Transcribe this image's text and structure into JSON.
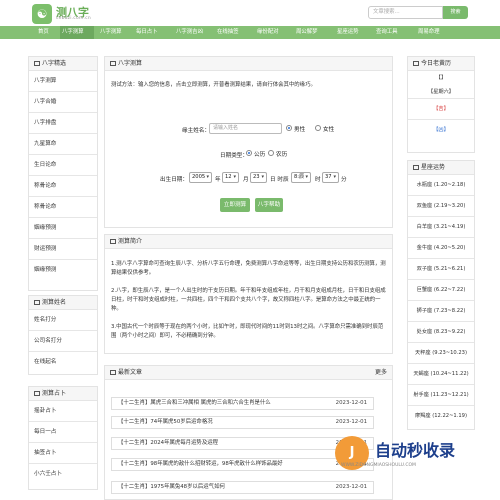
{
  "header": {
    "logo_char": "☯",
    "site_title": "测八字",
    "site_subtitle": "cebazi.com.cn",
    "search_placeholder": "文章搜索...",
    "search_button": "搜索"
  },
  "nav": [
    "首页",
    "八字测算",
    "八字测算",
    "每日占卜",
    "八字测吉凶",
    "在线抽签",
    "缘份配对",
    "周公解梦",
    "星座运势",
    "查询工具",
    "周易命理"
  ],
  "left": {
    "bazi_title": "八字精选",
    "bazi_items": [
      "八字测算",
      "八字合婚",
      "八字排盘",
      "九星算命",
      "生日论命",
      "称骨论命",
      "称骨论命",
      "姻缘预测",
      "财运预测",
      "姻缘预测"
    ],
    "name_title": "测算姓名",
    "name_items": [
      "姓名打分",
      "公司名打分",
      "在线起名"
    ],
    "divine_title": "测算占卜",
    "divine_items": [
      "摇卦占卜",
      "每日一占",
      "抽签占卜",
      "小六壬占卜"
    ]
  },
  "form": {
    "title": "八字测算",
    "intro": "测试方法：输入您的信息，点击立即测算，开普看测算结果，请自行体会其中的缘巧。",
    "name_label": "缘主姓名：",
    "name_placeholder": "请输入姓名",
    "male": "男性",
    "female": "女性",
    "date_type_label": "日期类型：",
    "solar": "公历",
    "lunar": "农历",
    "birth_label": "出生日期：",
    "year": "2005",
    "year_unit": "年",
    "month": "12",
    "month_unit": "月",
    "day": "23",
    "day_unit": "日 时辰",
    "hour": "8:辰",
    "hour_unit": "时",
    "minute": "37",
    "minute_unit": "分",
    "submit": "立即测算",
    "help": "八字帮助"
  },
  "intro": {
    "title": "测算简介",
    "p1": "1.测八字八字算命可查询生辰八字、分析八字五行命理，免费测算八字命运等等，出生日期支持公历和农历测算，测算结果仅供参考。",
    "p2": "2.八字，即生辰八字，是一个人出生时的干支历日期。年干和年支组成年柱，月干和月支组成月柱，日干和日支组成日柱，时干和时支组成时柱，一共四柱，四个干和四个支共八个字，故又称四柱八字。是算命方法之中最正统的一种。",
    "p3": "3.中国古代一个时辰等于现在的两个小时，比如午时，即现代时间的11时到13时之间。八字算命只需准确到时辰范围（两个小时之间）即可，不必精确到分钟。"
  },
  "articles": {
    "title": "最新文章",
    "more": "更多",
    "items": [
      {
        "tag": "【十二生肖】",
        "text": "属虎三合和三冲属相 属虎的三合和六合生肖是什么",
        "date": "2023-12-01"
      },
      {
        "tag": "【十二生肖】",
        "text": "74年属虎50岁后运命格况",
        "date": "2023-12-01"
      },
      {
        "tag": "【十二生肖】",
        "text": "2024年属虎每月运势及运程",
        "date": "2023-12-01"
      },
      {
        "tag": "【十二生肖】",
        "text": "98年属虎的敌什么招财转运，98年虎敌什么样饰品最好",
        "date": "2023-12-01"
      },
      {
        "tag": "【十二生肖】",
        "text": "1975年属兔48岁以后运气如何",
        "date": "2023-12-01"
      }
    ]
  },
  "right": {
    "today_title": "今日老黄历",
    "today_items": [
      "【】",
      "【星期六】",
      "【吉】",
      "【凶】"
    ],
    "star_title": "星座运势",
    "stars": [
      "水瓶座 (1.20~2.18)",
      "双鱼座 (2.19~3.20)",
      "白羊座 (3.21~4.19)",
      "金牛座 (4.20~5.20)",
      "双子座 (5.21~6.21)",
      "巨蟹座 (6.22~7.22)",
      "狮子座 (7.23~8.22)",
      "处女座 (8.23~9.22)",
      "天秤座 (9.23~10.23)",
      "天蝎座 (10.24~11.22)",
      "射手座 (11.23~12.21)",
      "摩羯座 (12.22~1.19)"
    ]
  },
  "watermark": {
    "text": "自动秒收录",
    "sub": "WWW.ZIDONGMIAOSHOULU.COM"
  }
}
